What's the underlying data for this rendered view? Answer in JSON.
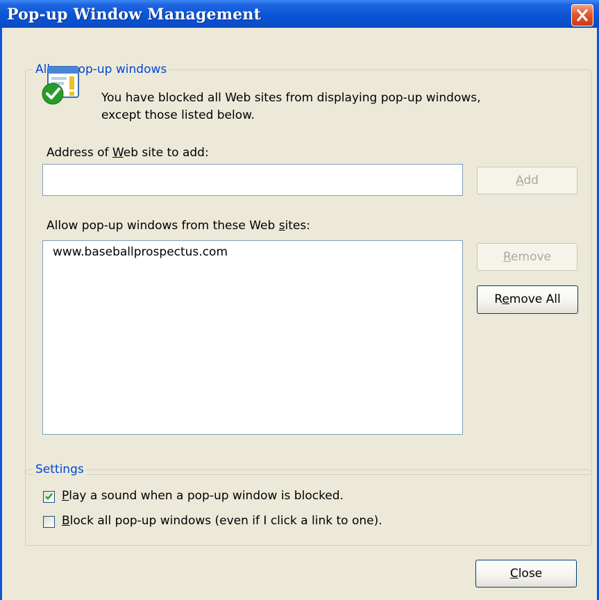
{
  "window": {
    "title": "Pop-up Window Management"
  },
  "allow_group": {
    "label": "Allow pop-up windows",
    "info_line1": "You have blocked all Web sites from displaying pop-up windows,",
    "info_line2": "except those listed below.",
    "address_label": "Address of Web site to add:",
    "address_value": "",
    "add_button": "Add",
    "list_label": "Allow pop-up windows from these Web sites:",
    "sites": [
      "www.baseballprospectus.com"
    ],
    "remove_button": "Remove",
    "remove_all_button": "Remove All"
  },
  "settings_group": {
    "label": "Settings",
    "play_sound_label": "Play a sound when a pop-up window is blocked.",
    "play_sound_checked": true,
    "block_all_label": "Block all pop-up windows (even if I click a link to one).",
    "block_all_checked": false
  },
  "footer": {
    "close_button": "Close"
  },
  "icons": {
    "title_close": "close-icon",
    "info": "popup-blocker-shield-icon",
    "check": "checkmark-icon"
  },
  "colors": {
    "titlebar": "#0a55d4",
    "client": "#ece9d8",
    "group_label": "#0046d5",
    "close_button": "#e0582e",
    "disabled_text": "#aca899"
  }
}
